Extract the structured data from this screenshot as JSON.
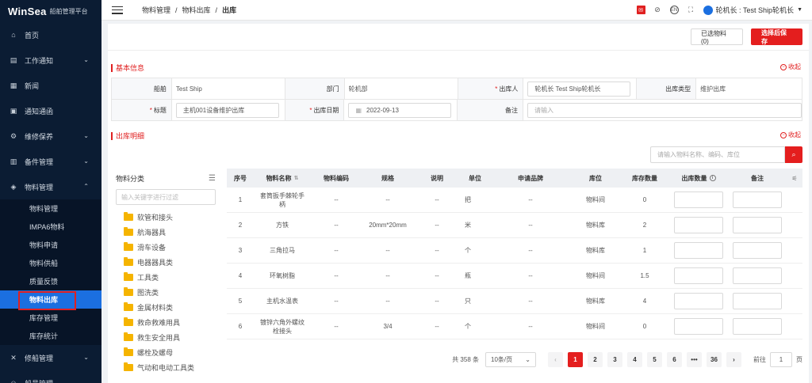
{
  "brand": {
    "logo": "WinSea",
    "subtitle": "船舶管理平台"
  },
  "sidebar": {
    "items": [
      {
        "label": "首页",
        "icon": "home-icon",
        "glyph": "⌂",
        "arrow": ""
      },
      {
        "label": "工作通知",
        "icon": "notice-icon",
        "glyph": "▤",
        "arrow": "⌄"
      },
      {
        "label": "新闻",
        "icon": "news-icon",
        "glyph": "▦",
        "arrow": ""
      },
      {
        "label": "通知通函",
        "icon": "circular-icon",
        "glyph": "▣",
        "arrow": ""
      },
      {
        "label": "维修保养",
        "icon": "maintenance-icon",
        "glyph": "⚙",
        "arrow": "⌄"
      },
      {
        "label": "备件管理",
        "icon": "spare-parts-icon",
        "glyph": "▥",
        "arrow": "⌄"
      },
      {
        "label": "物料管理",
        "icon": "material-icon",
        "glyph": "◈",
        "arrow": "⌃"
      }
    ],
    "submenu": [
      "物料管理",
      "IMPA6物料",
      "物料申请",
      "物料供船",
      "质量反馈",
      "物料出库",
      "库存管理",
      "库存统计"
    ],
    "active_submenu": "物料出库",
    "after": [
      {
        "label": "修船管理",
        "icon": "repair-icon",
        "glyph": "✕",
        "arrow": "⌄"
      },
      {
        "label": "船员管理",
        "icon": "crew-icon",
        "glyph": "☺",
        "arrow": "⌄"
      }
    ]
  },
  "header": {
    "breadcrumb": [
      "物料管理",
      "物料出库",
      "出库"
    ],
    "user": "轮机长 : Test Ship轮机长"
  },
  "toolbar": {
    "selected_label": "已选物料(0)",
    "save_label": "选择后保存"
  },
  "basic": {
    "title": "基本信息",
    "collapse": "收起",
    "ship_label": "船舶",
    "ship_value": "Test Ship",
    "dept_label": "部门",
    "dept_value": "轮机部",
    "outbound_person_label": "出库人",
    "outbound_person_value": "轮机长  Test Ship轮机长",
    "outbound_type_label": "出库类型",
    "outbound_type_value": "维护出库",
    "title_label": "标题",
    "title_value": "主机001设备维护出库",
    "date_label": "出库日期",
    "date_value": "2022-09-13",
    "remark_label": "备注",
    "remark_placeholder": "请输入"
  },
  "detail": {
    "title": "出库明细",
    "collapse": "收起",
    "search_placeholder": "请输入物料名称、编码、库位"
  },
  "category": {
    "title": "物料分类",
    "filter_placeholder": "输入关键字进行过滤",
    "items": [
      "软管和接头",
      "航海器具",
      "滑车设备",
      "电器器具类",
      "工具类",
      "图洗类",
      "金属材料类",
      "救命救难用具",
      "救生安全用具",
      "螺栓及螺母",
      "气动和电动工具类"
    ]
  },
  "table": {
    "headers": [
      "序号",
      "物料名称",
      "物料编码",
      "规格",
      "说明",
      "单位",
      "申请品牌",
      "库位",
      "库存数量",
      "出库数量",
      "备注"
    ],
    "rows": [
      {
        "no": "1",
        "name": "套筒扳手棘轮手柄",
        "code": "--",
        "spec": "--",
        "desc": "--",
        "unit": "把",
        "brand": "--",
        "loc": "物料间",
        "stock": "0"
      },
      {
        "no": "2",
        "name": "方铁",
        "code": "--",
        "spec": "20mm*20mm",
        "desc": "--",
        "unit": "米",
        "brand": "--",
        "loc": "物料库",
        "stock": "2"
      },
      {
        "no": "3",
        "name": "三角拉马",
        "code": "--",
        "spec": "--",
        "desc": "--",
        "unit": "个",
        "brand": "--",
        "loc": "物料库",
        "stock": "1"
      },
      {
        "no": "4",
        "name": "环氧树脂",
        "code": "--",
        "spec": "--",
        "desc": "--",
        "unit": "瓶",
        "brand": "--",
        "loc": "物料间",
        "stock": "1.5"
      },
      {
        "no": "5",
        "name": "主机水温表",
        "code": "--",
        "spec": "--",
        "desc": "--",
        "unit": "只",
        "brand": "--",
        "loc": "物料库",
        "stock": "4"
      },
      {
        "no": "6",
        "name": "镀锌六角外螺纹栓接头",
        "code": "--",
        "spec": "3/4",
        "desc": "--",
        "unit": "个",
        "brand": "--",
        "loc": "物料间",
        "stock": "0"
      }
    ]
  },
  "pagination": {
    "total": "共 358 条",
    "page_size": "10条/页",
    "pages": [
      "1",
      "2",
      "3",
      "4",
      "5",
      "6",
      "•••",
      "36"
    ],
    "current": "1",
    "goto_prefix": "前往",
    "goto_value": "1",
    "goto_suffix": "页"
  },
  "colors": {
    "accent": "#e41e1e",
    "sidebar_bg": "#0b1c33",
    "active_menu": "#1b6fe0"
  }
}
